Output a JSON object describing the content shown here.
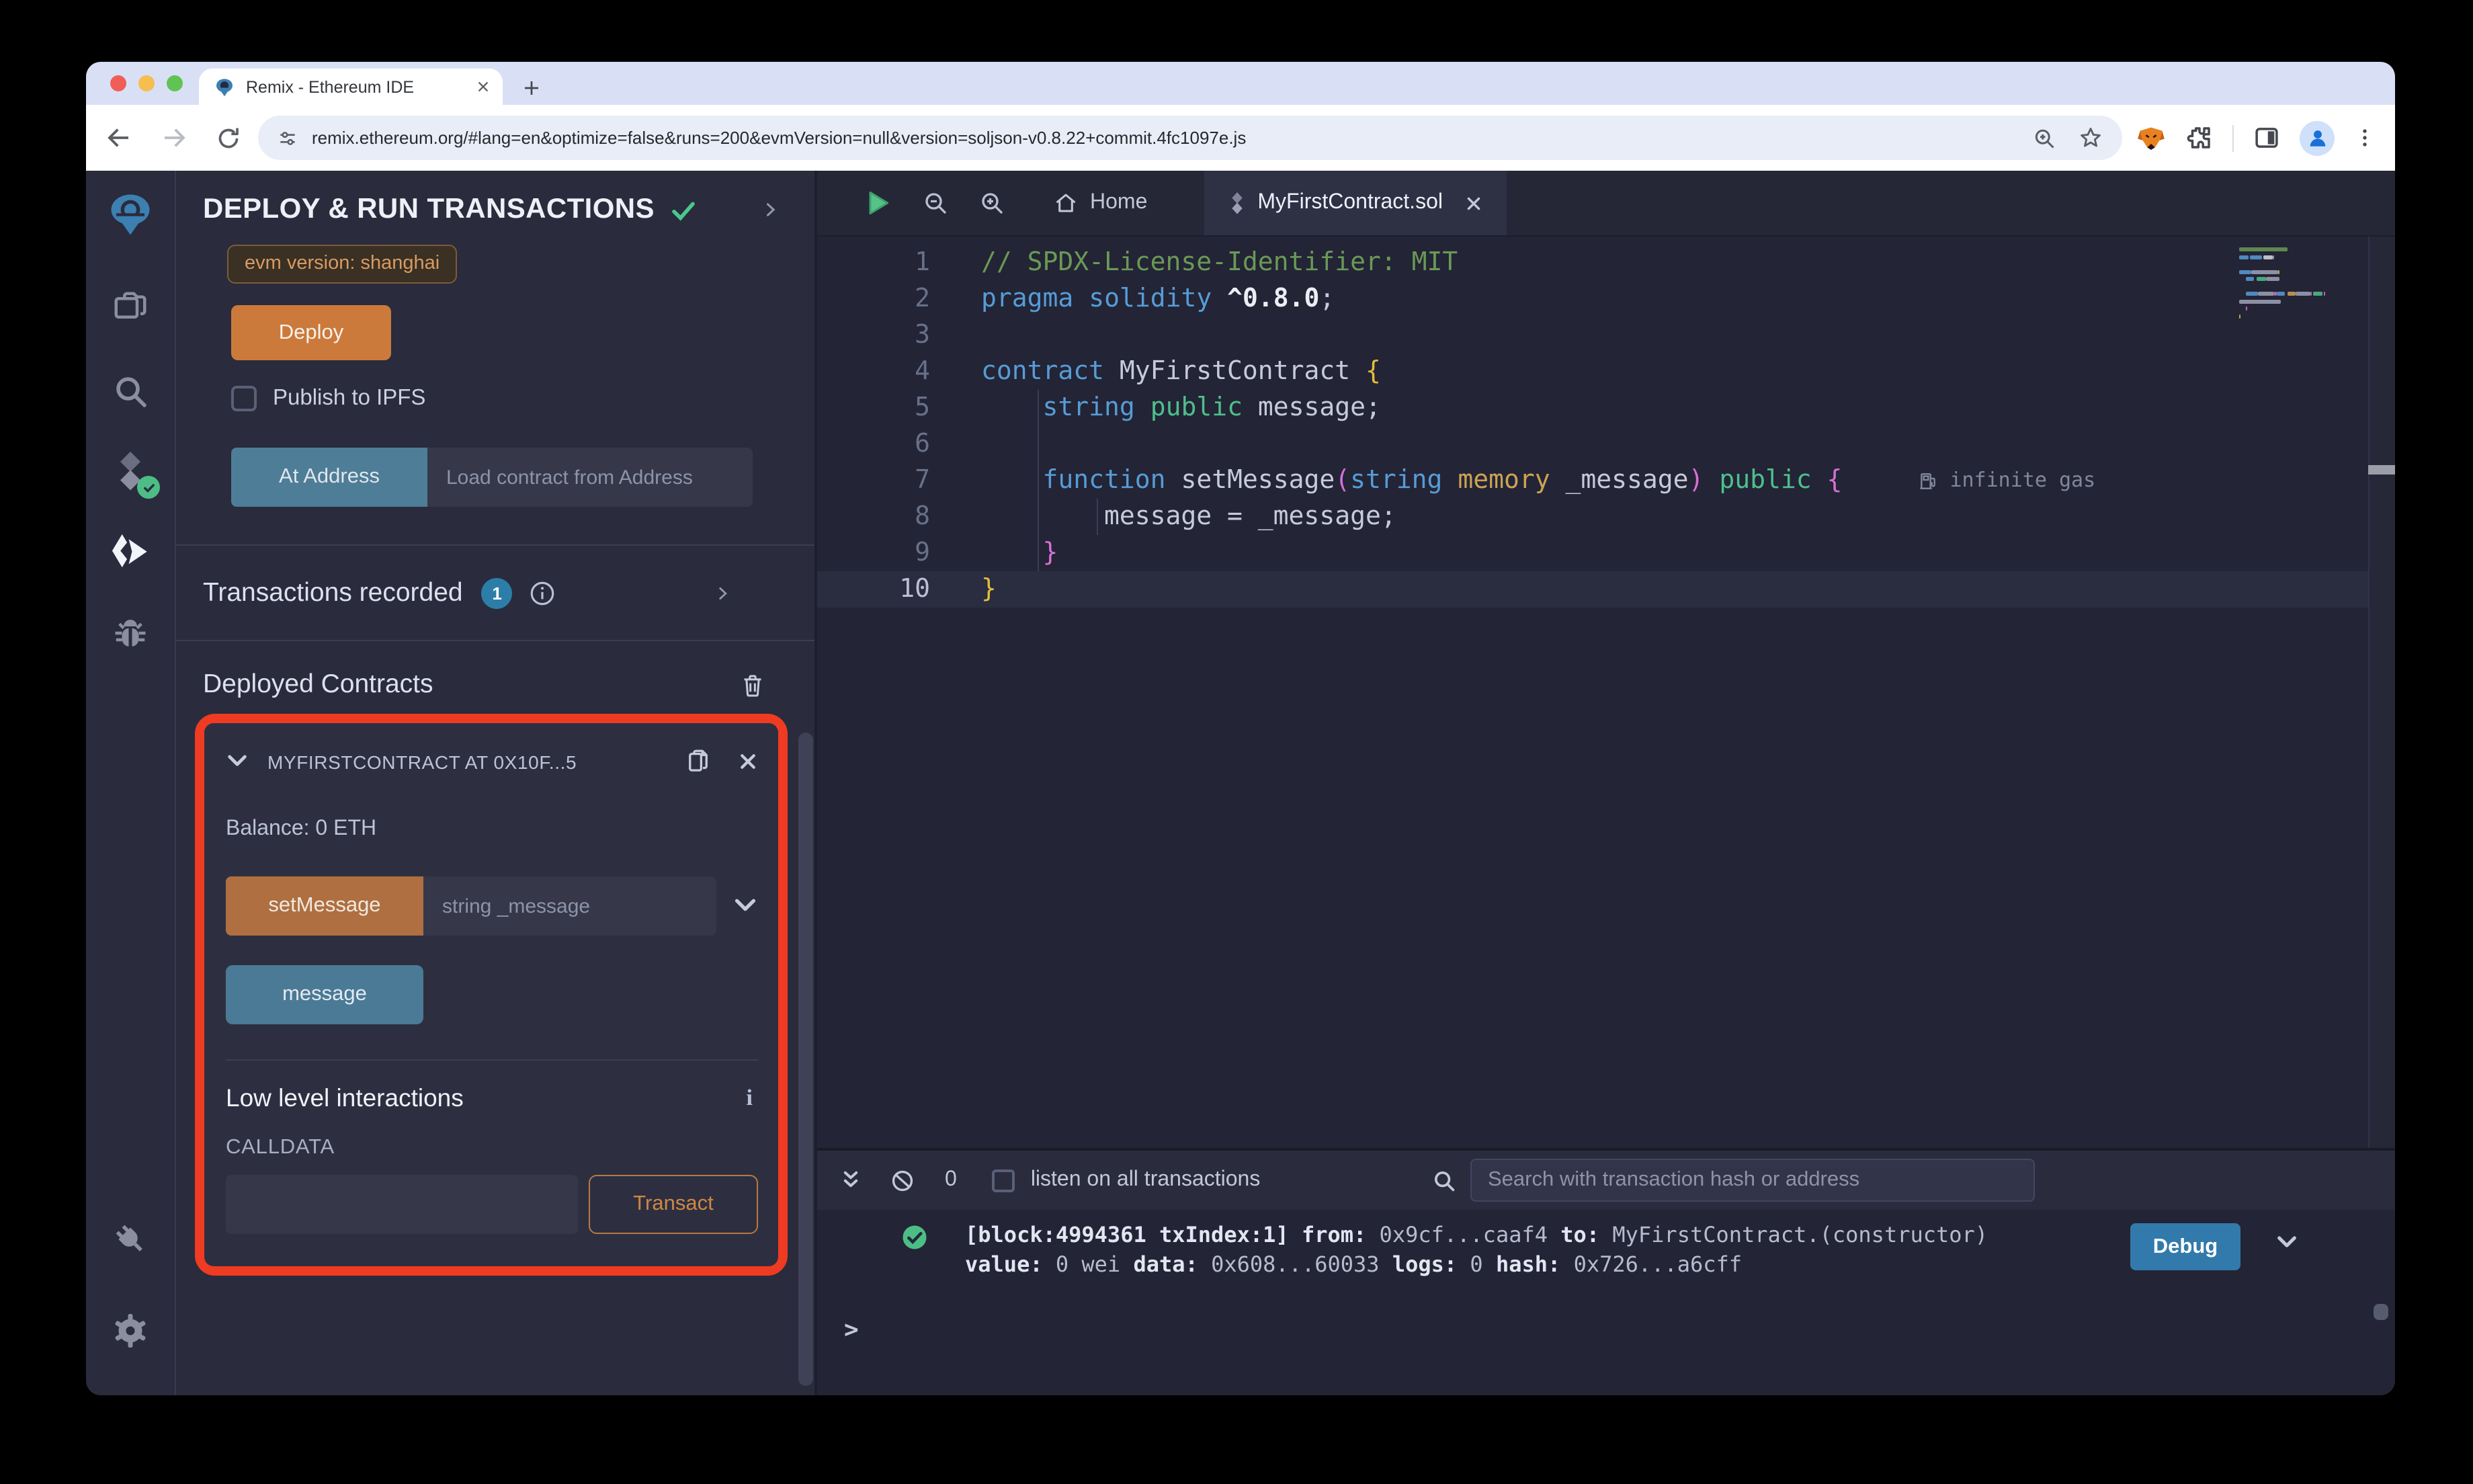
{
  "browser": {
    "tab_title": "Remix - Ethereum IDE",
    "url": "remix.ethereum.org/#lang=en&optimize=false&runs=200&evmVersion=null&version=soljson-v0.8.22+commit.4fc1097e.js"
  },
  "run_panel": {
    "title": "DEPLOY & RUN TRANSACTIONS",
    "evm_badge": "evm version: shanghai",
    "deploy_label": "Deploy",
    "publish_label": "Publish to IPFS",
    "at_address_label": "At Address",
    "at_address_placeholder": "Load contract from Address",
    "tx_recorded_label": "Transactions recorded",
    "tx_count": "1",
    "deployed_heading": "Deployed Contracts",
    "contract": {
      "title": "MYFIRSTCONTRACT AT 0X10F...5",
      "balance": "Balance: 0 ETH",
      "set_message_label": "setMessage",
      "set_message_placeholder": "string _message",
      "message_label": "message",
      "low_level_heading": "Low level interactions",
      "calldata_label": "CALLDATA",
      "transact_label": "Transact"
    }
  },
  "editor": {
    "home_tab": "Home",
    "file_tab": "MyFirstContract.sol",
    "gas_annotation": "infinite gas",
    "lines": [
      {
        "n": "1",
        "indent": 0,
        "tokens": [
          {
            "t": "// SPDX-License-Identifier: MIT",
            "c": "cm"
          }
        ]
      },
      {
        "n": "2",
        "indent": 0,
        "tokens": [
          {
            "t": "pragma",
            "c": "kw"
          },
          {
            "t": " ",
            "c": "pl"
          },
          {
            "t": "solidity",
            "c": "kw"
          },
          {
            "t": " ",
            "c": "pl"
          },
          {
            "t": "^0.8.0",
            "c": "wb"
          },
          {
            "t": ";",
            "c": "pl"
          }
        ]
      },
      {
        "n": "3",
        "indent": 0,
        "tokens": []
      },
      {
        "n": "4",
        "indent": 0,
        "tokens": [
          {
            "t": "contract",
            "c": "kw"
          },
          {
            "t": " MyFirstContract ",
            "c": "pl"
          },
          {
            "t": "{",
            "c": "by"
          }
        ]
      },
      {
        "n": "5",
        "indent": 1,
        "tokens": [
          {
            "t": "    ",
            "c": "pl"
          },
          {
            "t": "string",
            "c": "kw"
          },
          {
            "t": " ",
            "c": "pl"
          },
          {
            "t": "public",
            "c": "gr"
          },
          {
            "t": " message;",
            "c": "pl"
          }
        ]
      },
      {
        "n": "6",
        "indent": 1,
        "tokens": []
      },
      {
        "n": "7",
        "indent": 1,
        "gas": true,
        "tokens": [
          {
            "t": "    ",
            "c": "pl"
          },
          {
            "t": "function",
            "c": "kw"
          },
          {
            "t": " setMessage",
            "c": "pl"
          },
          {
            "t": "(",
            "c": "bp"
          },
          {
            "t": "string",
            "c": "kw"
          },
          {
            "t": " ",
            "c": "pl"
          },
          {
            "t": "memory",
            "c": "gd"
          },
          {
            "t": " _message",
            "c": "pl"
          },
          {
            "t": ")",
            "c": "bp"
          },
          {
            "t": " ",
            "c": "pl"
          },
          {
            "t": "public",
            "c": "gr"
          },
          {
            "t": " ",
            "c": "pl"
          },
          {
            "t": "{",
            "c": "bp"
          }
        ]
      },
      {
        "n": "8",
        "indent": 2,
        "tokens": [
          {
            "t": "        message = _message;",
            "c": "pl"
          }
        ]
      },
      {
        "n": "9",
        "indent": 1,
        "tokens": [
          {
            "t": "    ",
            "c": "pl"
          },
          {
            "t": "}",
            "c": "bp"
          }
        ]
      },
      {
        "n": "10",
        "indent": 0,
        "active": true,
        "tokens": [
          {
            "t": "}",
            "c": "by"
          }
        ]
      }
    ]
  },
  "terminal": {
    "count": "0",
    "listen_label": "listen on all transactions",
    "search_placeholder": "Search with transaction hash or address",
    "log_line1": [
      {
        "t": "[block:4994361 txIndex:1]",
        "b": true
      },
      {
        "t": "  "
      },
      {
        "t": "from:",
        "b": true
      },
      {
        "t": " 0x9cf...caaf4 "
      },
      {
        "t": "to:",
        "b": true
      },
      {
        "t": " MyFirstContract.(constructor) "
      }
    ],
    "log_line2": [
      {
        "t": "value:",
        "b": true
      },
      {
        "t": " 0 wei "
      },
      {
        "t": "data:",
        "b": true
      },
      {
        "t": " 0x608...60033 "
      },
      {
        "t": "logs:",
        "b": true
      },
      {
        "t": " 0 "
      },
      {
        "t": "hash:",
        "b": true
      },
      {
        "t": " 0x726...a6cff"
      }
    ],
    "debug_label": "Debug",
    "prompt": ">"
  },
  "colors": {
    "accent_orange": "#cb7a3c",
    "steel_blue_button": "#4e7d97",
    "badge_blue": "#2c7ea8",
    "highlight_red": "#ee3b22",
    "debug_blue": "#327aab",
    "success_green": "#4dbd85"
  }
}
